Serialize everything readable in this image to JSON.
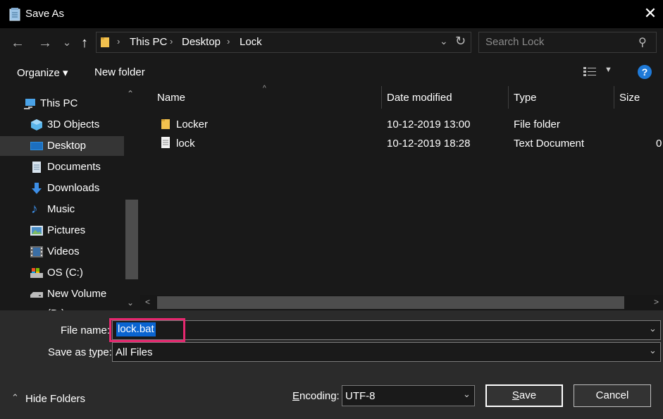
{
  "window": {
    "title": "Save As",
    "close_glyph": "✕"
  },
  "nav": {
    "back_glyph": "←",
    "forward_glyph": "→",
    "recent_glyph": "⌄",
    "up_glyph": "↑",
    "breadcrumb": [
      "This PC",
      "Desktop",
      "Lock"
    ],
    "sep_glyph": "›",
    "dd_glyph": "⌄",
    "refresh_glyph": "↻",
    "search_placeholder": "Search Lock",
    "search_glyph": "⚲"
  },
  "toolbar": {
    "organize_label": "Organize ▾",
    "new_folder_label": "New folder",
    "view_dd_glyph": "▼",
    "help_glyph": "?"
  },
  "sidebar": {
    "items": [
      {
        "label": "This PC",
        "icon": "computer-icon",
        "selected": false
      },
      {
        "label": "3D Objects",
        "icon": "cube-icon",
        "selected": false
      },
      {
        "label": "Desktop",
        "icon": "desktop-icon",
        "selected": true
      },
      {
        "label": "Documents",
        "icon": "documents-icon",
        "selected": false
      },
      {
        "label": "Downloads",
        "icon": "downloads-icon",
        "selected": false
      },
      {
        "label": "Music",
        "icon": "music-icon",
        "selected": false
      },
      {
        "label": "Pictures",
        "icon": "pictures-icon",
        "selected": false
      },
      {
        "label": "Videos",
        "icon": "videos-icon",
        "selected": false
      },
      {
        "label": "OS (C:)",
        "icon": "drive-icon",
        "selected": false
      },
      {
        "label": "New Volume (D:)",
        "icon": "volume-icon",
        "selected": false
      }
    ],
    "scroll_up_glyph": "⌃",
    "scroll_down_glyph": "⌄",
    "music_glyph": "♪"
  },
  "file_list": {
    "columns": [
      "Name",
      "Date modified",
      "Type",
      "Size"
    ],
    "sort_glyph": "^",
    "rows": [
      {
        "name": "Locker",
        "date": "10-12-2019 13:00",
        "type": "File folder",
        "size": "",
        "icon": "folder-icon"
      },
      {
        "name": "lock",
        "date": "10-12-2019 18:28",
        "type": "Text Document",
        "size": "0",
        "icon": "text-file-icon"
      }
    ],
    "scroll_left_glyph": "<",
    "scroll_right_glyph": ">"
  },
  "form": {
    "file_name_label": "File name:",
    "file_name_value": "lock.bat",
    "save_type_label_pre": "Save as ",
    "save_type_label_key": "t",
    "save_type_label_post": "ype:",
    "save_type_value": "All Files",
    "encoding_label_key": "E",
    "encoding_label_post": "ncoding:",
    "encoding_value": "UTF-8",
    "save_key": "S",
    "save_rest": "ave",
    "cancel_label": "Cancel",
    "hide_folders_label": "Hide Folders",
    "hide_folders_glyph": "⌃",
    "dd_glyph": "⌄"
  },
  "colors": {
    "accent": "#0a64d0",
    "highlight_box": "#e6286f",
    "help": "#1f7ad8",
    "folder": "#f2c14e"
  }
}
